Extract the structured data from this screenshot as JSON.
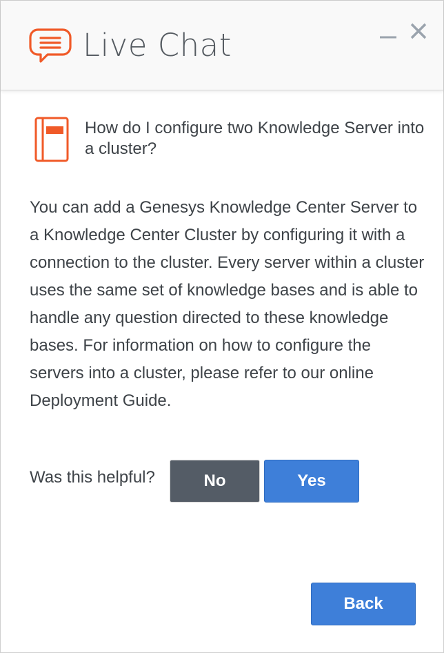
{
  "header": {
    "title": "Live Chat",
    "chat_icon": "chat-bubble-icon",
    "minimize_icon": "minimize-icon",
    "close_icon": "close-icon",
    "accent_color": "#f05a28"
  },
  "article": {
    "icon": "book-icon",
    "question": "How do I configure two Knowledge Server into a cluster?",
    "answer": "You can add a Genesys Knowledge Center Server to a Knowledge Center Cluster by configuring it with a connection to the cluster. Every server within a cluster uses the same set of knowledge bases and is able to handle any question directed to these knowledge bases. For information on how to configure the servers into a cluster, please refer to our online Deployment Guide."
  },
  "feedback": {
    "label": "Was this helpful?",
    "no_label": "No",
    "yes_label": "Yes"
  },
  "footer": {
    "back_label": "Back"
  },
  "colors": {
    "primary_button": "#3e7fd9",
    "secondary_button": "#545c66",
    "text": "#3e4348"
  }
}
